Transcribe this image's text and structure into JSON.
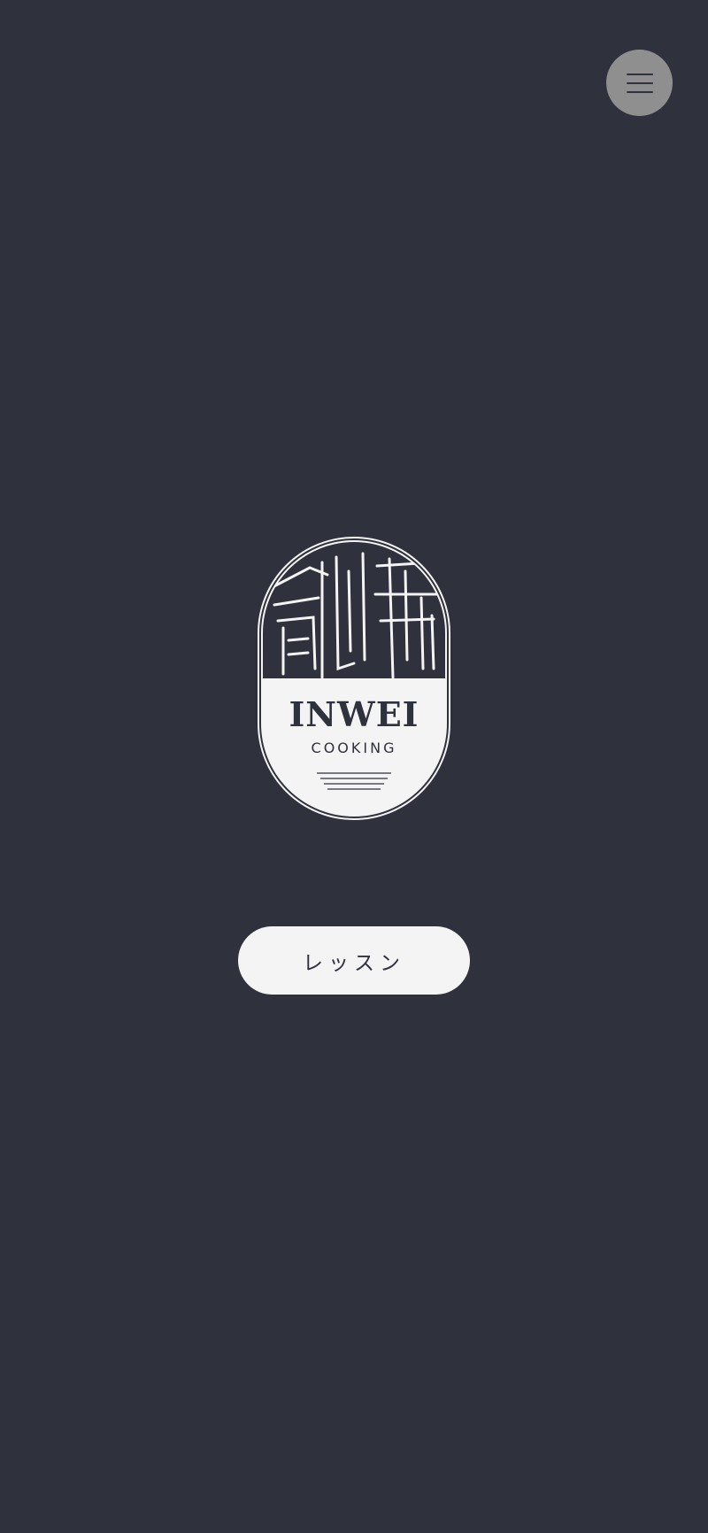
{
  "header": {
    "menu_icon": "hamburger-menu-icon"
  },
  "logo": {
    "name": "INWEI",
    "subtitle": "COOKING",
    "emblem_icon": "inwei-seal-logo"
  },
  "actions": {
    "lesson_label": "レッスン"
  },
  "colors": {
    "background": "#2f313c",
    "menu_button": "#8f8f90",
    "logo_fill": "#f4f4f4",
    "button_bg": "#f4f4f4"
  }
}
